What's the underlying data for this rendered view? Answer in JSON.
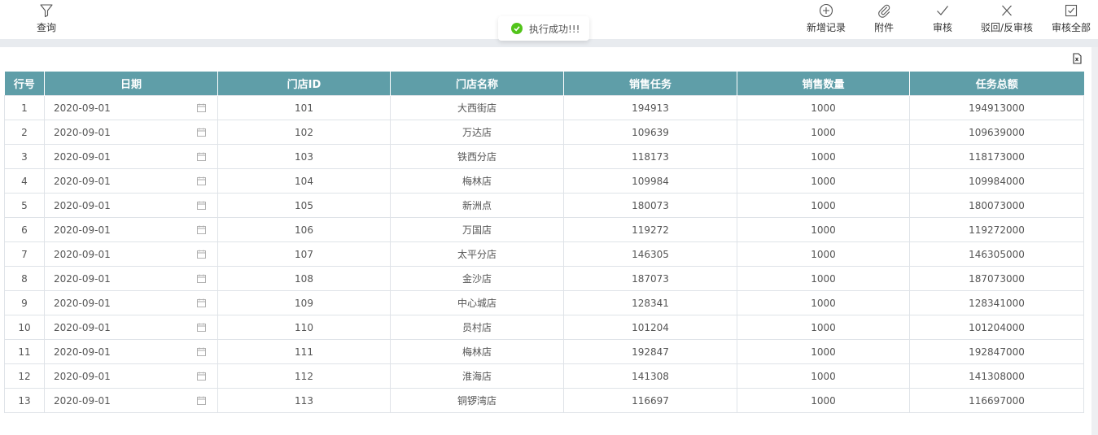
{
  "toolbar": {
    "query_label": "查询",
    "add_label": "新增记录",
    "attach_label": "附件",
    "audit_label": "审核",
    "reject_label": "驳回/反审核",
    "audit_all_label": "审核全部"
  },
  "toast": {
    "message": "执行成功!!!"
  },
  "table": {
    "headers": [
      "行号",
      "日期",
      "门店ID",
      "门店名称",
      "销售任务",
      "销售数量",
      "任务总额"
    ],
    "rows": [
      [
        "1",
        "2020-09-01",
        "101",
        "大西街店",
        "194913",
        "1000",
        "194913000"
      ],
      [
        "2",
        "2020-09-01",
        "102",
        "万达店",
        "109639",
        "1000",
        "109639000"
      ],
      [
        "3",
        "2020-09-01",
        "103",
        "铁西分店",
        "118173",
        "1000",
        "118173000"
      ],
      [
        "4",
        "2020-09-01",
        "104",
        "梅林店",
        "109984",
        "1000",
        "109984000"
      ],
      [
        "5",
        "2020-09-01",
        "105",
        "新洲点",
        "180073",
        "1000",
        "180073000"
      ],
      [
        "6",
        "2020-09-01",
        "106",
        "万国店",
        "119272",
        "1000",
        "119272000"
      ],
      [
        "7",
        "2020-09-01",
        "107",
        "太平分店",
        "146305",
        "1000",
        "146305000"
      ],
      [
        "8",
        "2020-09-01",
        "108",
        "金沙店",
        "187073",
        "1000",
        "187073000"
      ],
      [
        "9",
        "2020-09-01",
        "109",
        "中心城店",
        "128341",
        "1000",
        "128341000"
      ],
      [
        "10",
        "2020-09-01",
        "110",
        "员村店",
        "101204",
        "1000",
        "101204000"
      ],
      [
        "11",
        "2020-09-01",
        "111",
        "梅林店",
        "192847",
        "1000",
        "192847000"
      ],
      [
        "12",
        "2020-09-01",
        "112",
        "淮海店",
        "141308",
        "1000",
        "141308000"
      ],
      [
        "13",
        "2020-09-01",
        "113",
        "铜锣湾店",
        "116697",
        "1000",
        "116697000"
      ]
    ]
  },
  "colors": {
    "header_bg": "#5f9ea8",
    "success": "#52c41a",
    "band": "#e8ebef"
  },
  "icons": [
    "filter-icon",
    "add-circle-icon",
    "paperclip-icon",
    "check-icon",
    "close-x-icon",
    "checkbox-icon",
    "success-check-icon",
    "calendar-icon",
    "export-icon"
  ]
}
